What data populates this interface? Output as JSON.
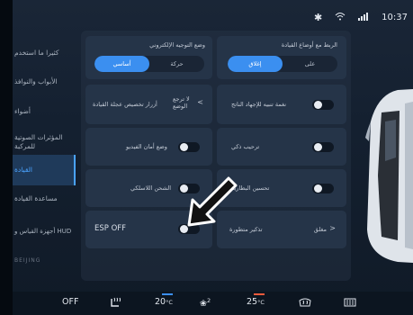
{
  "status": {
    "bluetooth_icon": "bluetooth-icon",
    "wifi_icon": "wifi-icon",
    "signal_icon": "signal-icon",
    "time": "10:37"
  },
  "sidebar": {
    "items": [
      {
        "label": "كثيرا ما استخدم"
      },
      {
        "label": "الأبواب والنوافذ"
      },
      {
        "label": "أضواء"
      },
      {
        "label": "المؤثرات الصوتية للمركبة"
      },
      {
        "label": "القيادة"
      },
      {
        "label": "مساعدة القيادة"
      },
      {
        "label": "أجهزة القياس و HUD"
      }
    ],
    "logo_text": "BEIJING"
  },
  "main": {
    "steering_mode": {
      "label": "وضع التوجيه الإلكتروني",
      "options": [
        "أساسي",
        "حركة"
      ],
      "selected": "أساسي"
    },
    "drive_mode_link": {
      "label": "الربط مع أوضاع القيادة",
      "options": [
        "إغلاق",
        "على"
      ],
      "selected": "إغلاق"
    },
    "custom_buttons": {
      "label": "أزرار تخصيص عجلة القيادة",
      "value": "لا ترجع الوضع"
    },
    "fatigue_alert": {
      "label": "نغمة تنبيه للإجهاد الناتج",
      "state": "off"
    },
    "video_safety": {
      "label": "وضع أمان الفيديو",
      "state": "off"
    },
    "welcome": {
      "label": "ترحيب ذكي",
      "state": "off"
    },
    "wireless_charging": {
      "label": "الشحن اللاسلكي",
      "state": "off"
    },
    "battery_improve": {
      "label": "تحسين البطارية",
      "state": "off"
    },
    "esp": {
      "label": "ESP OFF",
      "state": "off"
    },
    "advanced_reminder": {
      "label": "تذكير متطورة",
      "value": "مغلق"
    }
  },
  "bottom": {
    "ac_off": "OFF",
    "seat_heat_icon": "seat-heat-icon",
    "left_temp": "20",
    "left_unit": "°C",
    "fan_icon": "fan-icon",
    "fan_level": "2",
    "right_temp": "25",
    "right_unit": "°C",
    "rear_defrost_icon": "rear-defrost-icon",
    "front_defrost_icon": "front-defrost-icon",
    "colors": {
      "cool": "#3b8ff0",
      "warm": "#f05a3b"
    }
  }
}
